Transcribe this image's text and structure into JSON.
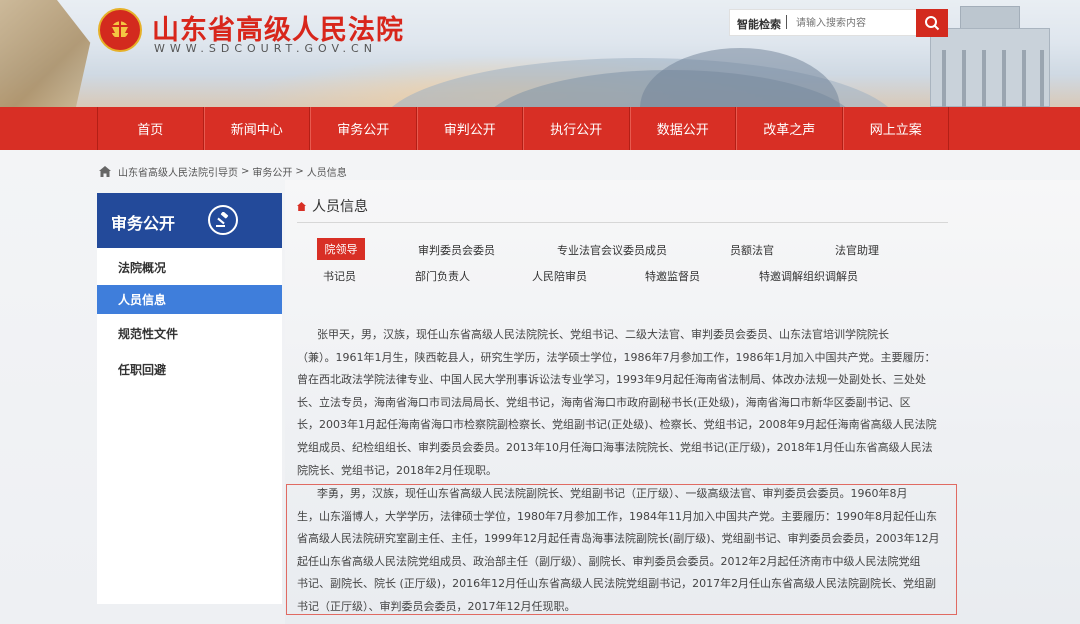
{
  "site": {
    "title": "山东省高级人民法院",
    "url": "WWW.SDCOURT.GOV.CN"
  },
  "search": {
    "label": "智能检索",
    "placeholder": "请输入搜索内容"
  },
  "nav": [
    "首页",
    "新闻中心",
    "审务公开",
    "审判公开",
    "执行公开",
    "数据公开",
    "改革之声",
    "网上立案"
  ],
  "breadcrumb": [
    "山东省高级人民法院引导页",
    "审务公开",
    "人员信息"
  ],
  "sidebar": {
    "title": "审务公开",
    "items": [
      "法院概况",
      "人员信息",
      "规范性文件",
      "任职回避"
    ],
    "active": "人员信息"
  },
  "main": {
    "title": "人员信息",
    "tabs_row1": [
      "院领导",
      "审判委员会委员",
      "专业法官会议委员成员",
      "员额法官",
      "法官助理"
    ],
    "tabs_row2": [
      "书记员",
      "部门负责人",
      "人民陪审员",
      "特邀监督员",
      "特邀调解组织调解员"
    ],
    "active_tab": "院领导",
    "profiles": [
      {
        "lines": [
          "张甲天，男，汉族，现任山东省高级人民法院院长、党组书记、二级大法官、审判委员会委员、山东法官培训学院院长",
          "（兼）。1961年1月生，陕西乾县人，研究生学历，法学硕士学位，1986年7月参加工作，1986年1月加入中国共产党。主要履历：",
          "曾在西北政法学院法律专业、中国人民大学刑事诉讼法专业学习，1993年9月起任海南省法制局、体改办法规一处副处长、三处处",
          "长、立法专员，海南省海口市司法局局长、党组书记，海南省海口市政府副秘书长(正处级)，海南省海口市新华区委副书记、区",
          "长，2003年1月起任海南省海口市检察院副检察长、党组副书记(正处级)、检察长、党组书记，2008年9月起任海南省高级人民法院",
          "党组成员、纪检组组长、审判委员会委员。2013年10月任海口海事法院院长、党组书记(正厅级)，2018年1月任山东省高级人民法",
          "院院长、党组书记，2018年2月任现职。"
        ]
      },
      {
        "lines": [
          "李勇，男，汉族，现任山东省高级人民法院副院长、党组副书记（正厅级）、一级高级法官、审判委员会委员。1960年8月",
          "生，山东淄博人，大学学历，法律硕士学位，1980年7月参加工作，1984年11月加入中国共产党。主要履历：1990年8月起任山东",
          "省高级人民法院研究室副主任、主任，1999年12月起任青岛海事法院副院长(副厅级)、党组副书记、审判委员会委员，2003年12月",
          "起任山东省高级人民法院党组成员、政治部主任（副厅级）、副院长、审判委员会委员。2012年2月起任济南市中级人民法院党组",
          "书记、副院长、院长 (正厅级)，2016年12月任山东省高级人民法院党组副书记，2017年2月任山东省高级人民法院副院长、党组副",
          "书记（正厅级）、审判委员会委员，2017年12月任现职。"
        ]
      }
    ]
  },
  "colors": {
    "brand_red": "#d82f25",
    "sidebar_blue": "#234a9a",
    "active_blue": "#3f7edb"
  }
}
